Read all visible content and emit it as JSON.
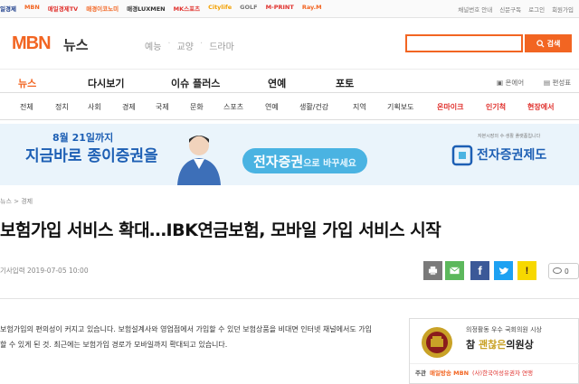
{
  "colors": {
    "brand": "#f26522",
    "blue": "#1d5fb4",
    "red": "#e0312d"
  },
  "topbar": {
    "family": [
      {
        "label": "일경제",
        "color": "#1a3c8a"
      },
      {
        "label": "MBN",
        "color": "#f26522"
      },
      {
        "label": "매일경제TV",
        "color": "#e0312d"
      },
      {
        "label": "매경이코노미",
        "color": "#f26522"
      },
      {
        "label": "매경LUXMEN",
        "color": "#333"
      },
      {
        "label": "MK스포츠",
        "color": "#e0312d"
      },
      {
        "label": "Citylife",
        "color": "#f2a000"
      },
      {
        "label": "GOLF",
        "color": "#777"
      },
      {
        "label": "M-PRINT",
        "color": "#e0312d"
      },
      {
        "label": "Ray.M",
        "color": "#f26522"
      }
    ],
    "util": [
      "채널번호 안내",
      "신문구독",
      "로그인",
      "회원가입"
    ]
  },
  "header": {
    "logo": "MBN",
    "logo_sub": "뉴스",
    "services": [
      "예능",
      "교양",
      "드라마"
    ],
    "search_button": "검색"
  },
  "gnb": {
    "items": [
      "뉴스",
      "다시보기",
      "이슈 플러스",
      "연예",
      "포토"
    ],
    "right": [
      "온에어",
      "편성표"
    ]
  },
  "lnb": {
    "items": [
      "전체",
      "정치",
      "사회",
      "경제",
      "국제",
      "문화",
      "스포츠",
      "연예",
      "생활/건강",
      "지역",
      "기획보도",
      "온마이크",
      "인기척",
      "현장에서"
    ]
  },
  "banner": {
    "line1": "8월 21일까지",
    "line2": "지금바로 종이증권을",
    "pill_big": "전자증권",
    "pill_small": "으로 바꾸세요",
    "small": "자본시장의 수·생활 플랫폼입니다",
    "logo_text": "전자증권제도"
  },
  "article": {
    "breadcrumb": "뉴스 > 경제",
    "headline": "보험가입 서비스 확대…IBK연금보험, 모바일 가입 서비스 시작",
    "meta_label": "기사입력",
    "meta_time": "2019-07-05 10:00",
    "comment_count": "0",
    "body": "보험가입의 편의성이 커지고 있습니다. 보험설계사와 영업점에서 가입할 수 있던 보험상품을 비대면 인터넷 채널에서도 가입할 수 있게 된 것. 최근에는 보험가입 경로가 모바일까지 확대되고 있습니다."
  },
  "ad": {
    "top": "의정활동 우수 국회의원 시상",
    "name_prefix": "참",
    "name_mid": "괜찮은",
    "name_suffix": "의원상",
    "host_label": "주관",
    "host1": "매일방송 MBN",
    "host2": "(사)한국여성유권자 연맹"
  }
}
